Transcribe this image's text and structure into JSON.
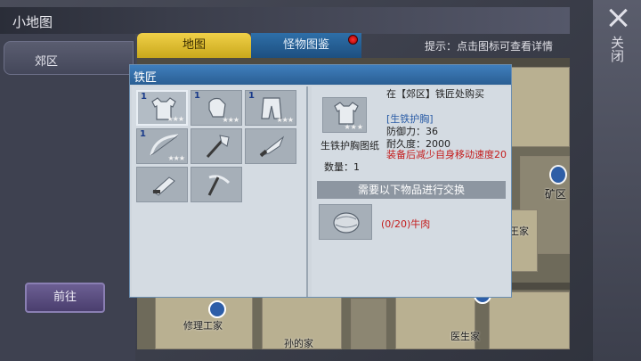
{
  "header": {
    "title": "小地图"
  },
  "sidebar": {
    "area": "郊区",
    "goto": "前往"
  },
  "close": {
    "label": "关闭"
  },
  "tabs": [
    {
      "label": "地图"
    },
    {
      "label": "怪物图鉴"
    }
  ],
  "hint": "提示：点击图标可查看详情",
  "map": {
    "labels": [
      "矿区",
      "修理工家",
      "孙的家",
      "医生家",
      "王家"
    ]
  },
  "dialog": {
    "title": "铁匠",
    "slots": [
      {
        "num": "1",
        "stars": "★★★",
        "icon": "chest-armor-icon",
        "selected": true
      },
      {
        "num": "1",
        "stars": "★★★",
        "icon": "gauntlet-icon"
      },
      {
        "num": "1",
        "stars": "★★★",
        "icon": "pants-icon"
      },
      {
        "num": "1",
        "stars": "★★★",
        "icon": "bow-icon"
      },
      {
        "num": "",
        "stars": "",
        "icon": "axe-icon"
      },
      {
        "num": "",
        "stars": "",
        "icon": "knife-icon"
      },
      {
        "num": "",
        "stars": "",
        "icon": "pipe-gun-icon"
      },
      {
        "num": "",
        "stars": "",
        "icon": "pickaxe-icon"
      }
    ],
    "detail": {
      "buy_at": "在【郊区】铁匠处购买",
      "item_name": "生铁护胸图纸",
      "qty_label": "数量：1",
      "equip_name": "[生铁护胸]",
      "defense": "防御力：36",
      "durability": "耐久度：2000",
      "penalty": "装备后减少自身移动速度20",
      "need_label": "需要以下物品进行交换",
      "material": "(0/20)牛肉",
      "detail_stars": "★★★"
    }
  },
  "colors": {
    "accent_blue": "#2f6fad",
    "tab_gold": "#e0c030",
    "warning_red": "#c41c1c"
  }
}
